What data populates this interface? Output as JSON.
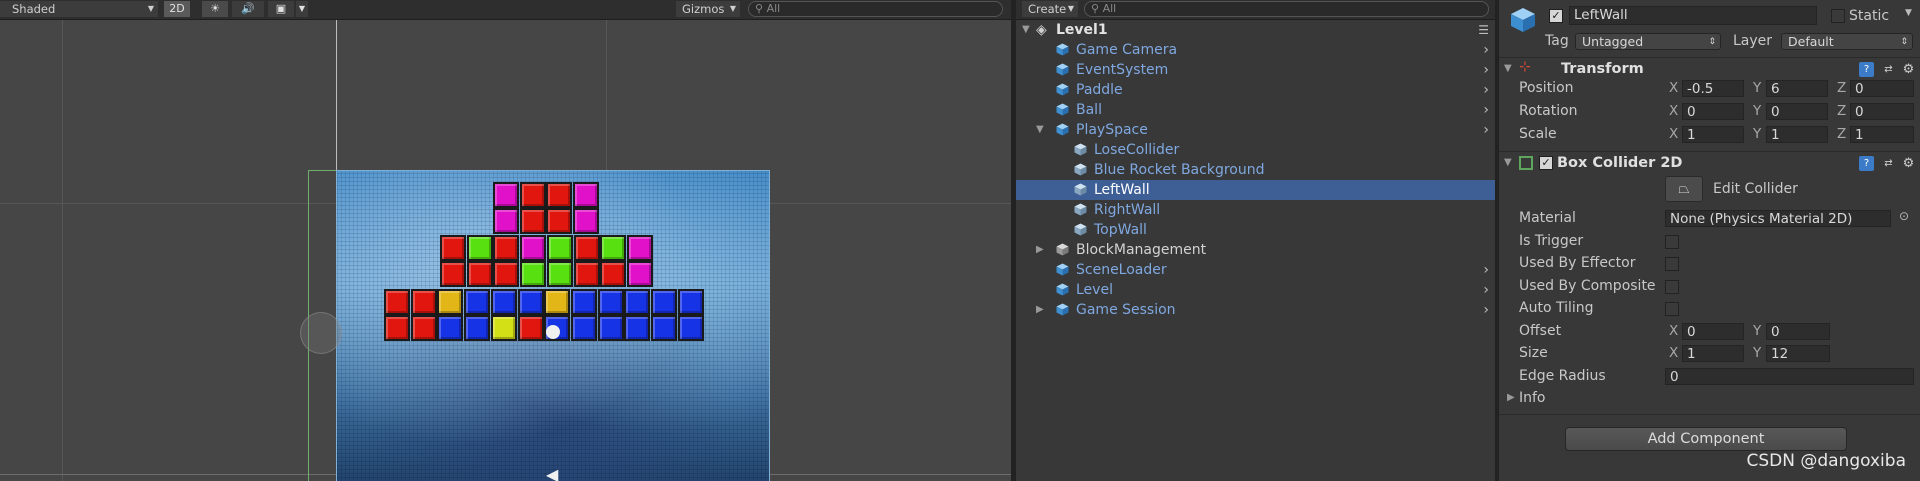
{
  "scene": {
    "shading_mode": "Shaded",
    "mode_2d": "2D",
    "gizmos_label": "Gizmos",
    "search_placeholder": "All",
    "block_colors": {
      "red": "#e0160f",
      "magenta": "#e011c9",
      "green": "#58e011",
      "blue": "#1733e6",
      "yellow": "#e3b618",
      "lime": "#d4e016"
    }
  },
  "hierarchy": {
    "create_label": "Create",
    "search_placeholder": "All",
    "scene_name": "Level1",
    "items": [
      {
        "label": "Game Camera"
      },
      {
        "label": "EventSystem"
      },
      {
        "label": "Paddle"
      },
      {
        "label": "Ball"
      },
      {
        "label": "PlaySpace"
      },
      {
        "label": "LoseCollider"
      },
      {
        "label": "Blue Rocket Background"
      },
      {
        "label": "LeftWall"
      },
      {
        "label": "RightWall"
      },
      {
        "label": "TopWall"
      },
      {
        "label": "BlockManagement"
      },
      {
        "label": "SceneLoader"
      },
      {
        "label": "Level"
      },
      {
        "label": "Game Session"
      }
    ]
  },
  "inspector": {
    "object_name": "LeftWall",
    "static_label": "Static",
    "tag_label": "Tag",
    "tag_value": "Untagged",
    "layer_label": "Layer",
    "layer_value": "Default",
    "transform": {
      "title": "Transform",
      "position_label": "Position",
      "position": {
        "x": "-0.5",
        "y": "6",
        "z": "0"
      },
      "rotation_label": "Rotation",
      "rotation": {
        "x": "0",
        "y": "0",
        "z": "0"
      },
      "scale_label": "Scale",
      "scale": {
        "x": "1",
        "y": "1",
        "z": "1"
      }
    },
    "collider": {
      "title": "Box Collider 2D",
      "edit_collider_label": "Edit Collider",
      "material_label": "Material",
      "material_value": "None (Physics Material 2D)",
      "is_trigger_label": "Is Trigger",
      "used_by_effector_label": "Used By Effector",
      "used_by_composite_label": "Used By Composite",
      "auto_tiling_label": "Auto Tiling",
      "offset_label": "Offset",
      "offset": {
        "x": "0",
        "y": "0"
      },
      "size_label": "Size",
      "size": {
        "x": "1",
        "y": "12"
      },
      "edge_radius_label": "Edge Radius",
      "edge_radius": "0",
      "info_label": "Info"
    },
    "add_component_label": "Add Component"
  },
  "axes": {
    "x": "X",
    "y": "Y",
    "z": "Z"
  },
  "watermark": "CSDN @dangoxiba"
}
